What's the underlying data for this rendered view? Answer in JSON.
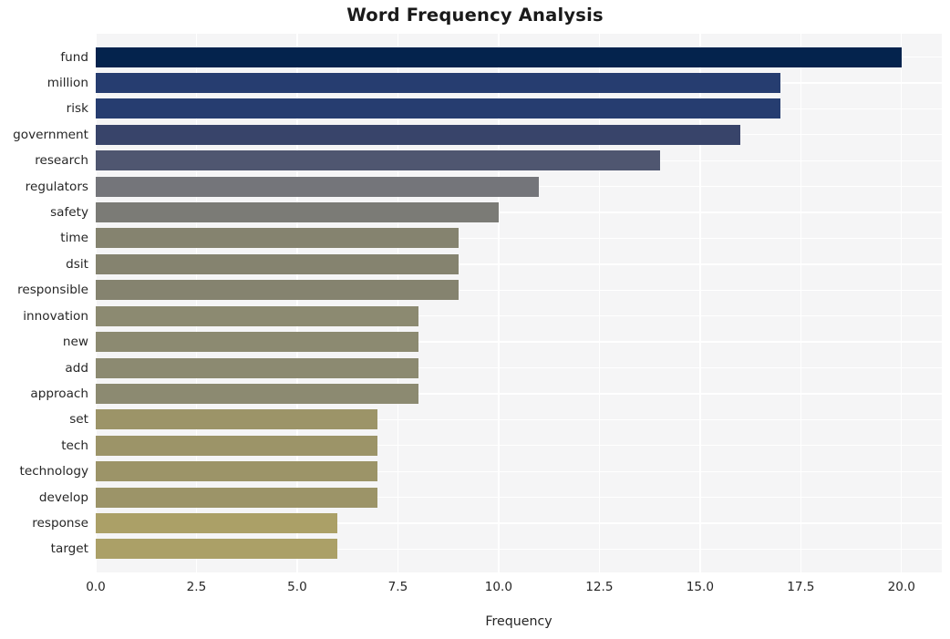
{
  "chart_data": {
    "type": "bar",
    "orientation": "horizontal",
    "title": "Word Frequency Analysis",
    "xlabel": "Frequency",
    "ylabel": "",
    "categories": [
      "fund",
      "million",
      "risk",
      "government",
      "research",
      "regulators",
      "safety",
      "time",
      "dsit",
      "responsible",
      "innovation",
      "new",
      "add",
      "approach",
      "set",
      "tech",
      "technology",
      "develop",
      "response",
      "target"
    ],
    "values": [
      20,
      17,
      17,
      16,
      14,
      11,
      10,
      9,
      9,
      9,
      8,
      8,
      8,
      8,
      7,
      7,
      7,
      7,
      6,
      6
    ],
    "bar_colors": [
      "#04234d",
      "#263d70",
      "#263d70",
      "#38446a",
      "#4f5670",
      "#74757a",
      "#7b7b76",
      "#85836f",
      "#85836f",
      "#85836f",
      "#8c8a71",
      "#8c8a71",
      "#8c8a71",
      "#8c8a71",
      "#9c9468",
      "#9c9468",
      "#9c9468",
      "#9c9468",
      "#aba067",
      "#aba067"
    ],
    "xlim": [
      0.0,
      21.0
    ],
    "xticks": [
      0.0,
      2.5,
      5.0,
      7.5,
      10.0,
      12.5,
      15.0,
      17.5,
      20.0
    ],
    "xtick_labels": [
      "0.0",
      "2.5",
      "5.0",
      "7.5",
      "10.0",
      "12.5",
      "15.0",
      "17.5",
      "20.0"
    ],
    "grid": true,
    "legend": "none",
    "plot_background": "#f5f5f6",
    "grid_color": "#ffffff",
    "figure_background": "#ffffff"
  }
}
